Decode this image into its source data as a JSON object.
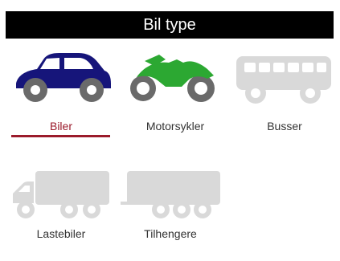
{
  "header": {
    "title": "Bil type"
  },
  "vehicles": [
    {
      "label": "Biler",
      "icon": "car-icon",
      "selected": true,
      "color": "#16157a"
    },
    {
      "label": "Motorsykler",
      "icon": "motorcycle-icon",
      "selected": false,
      "color": "#2ca832"
    },
    {
      "label": "Busser",
      "icon": "bus-icon",
      "selected": false,
      "color": "#d9d9d9"
    },
    {
      "label": "Lastebiler",
      "icon": "truck-icon",
      "selected": false,
      "color": "#d9d9d9"
    },
    {
      "label": "Tilhengere",
      "icon": "trailer-icon",
      "selected": false,
      "color": "#d9d9d9"
    }
  ],
  "colors": {
    "accent": "#9b1b2b",
    "header_bg": "#000000",
    "inactive": "#d9d9d9"
  }
}
